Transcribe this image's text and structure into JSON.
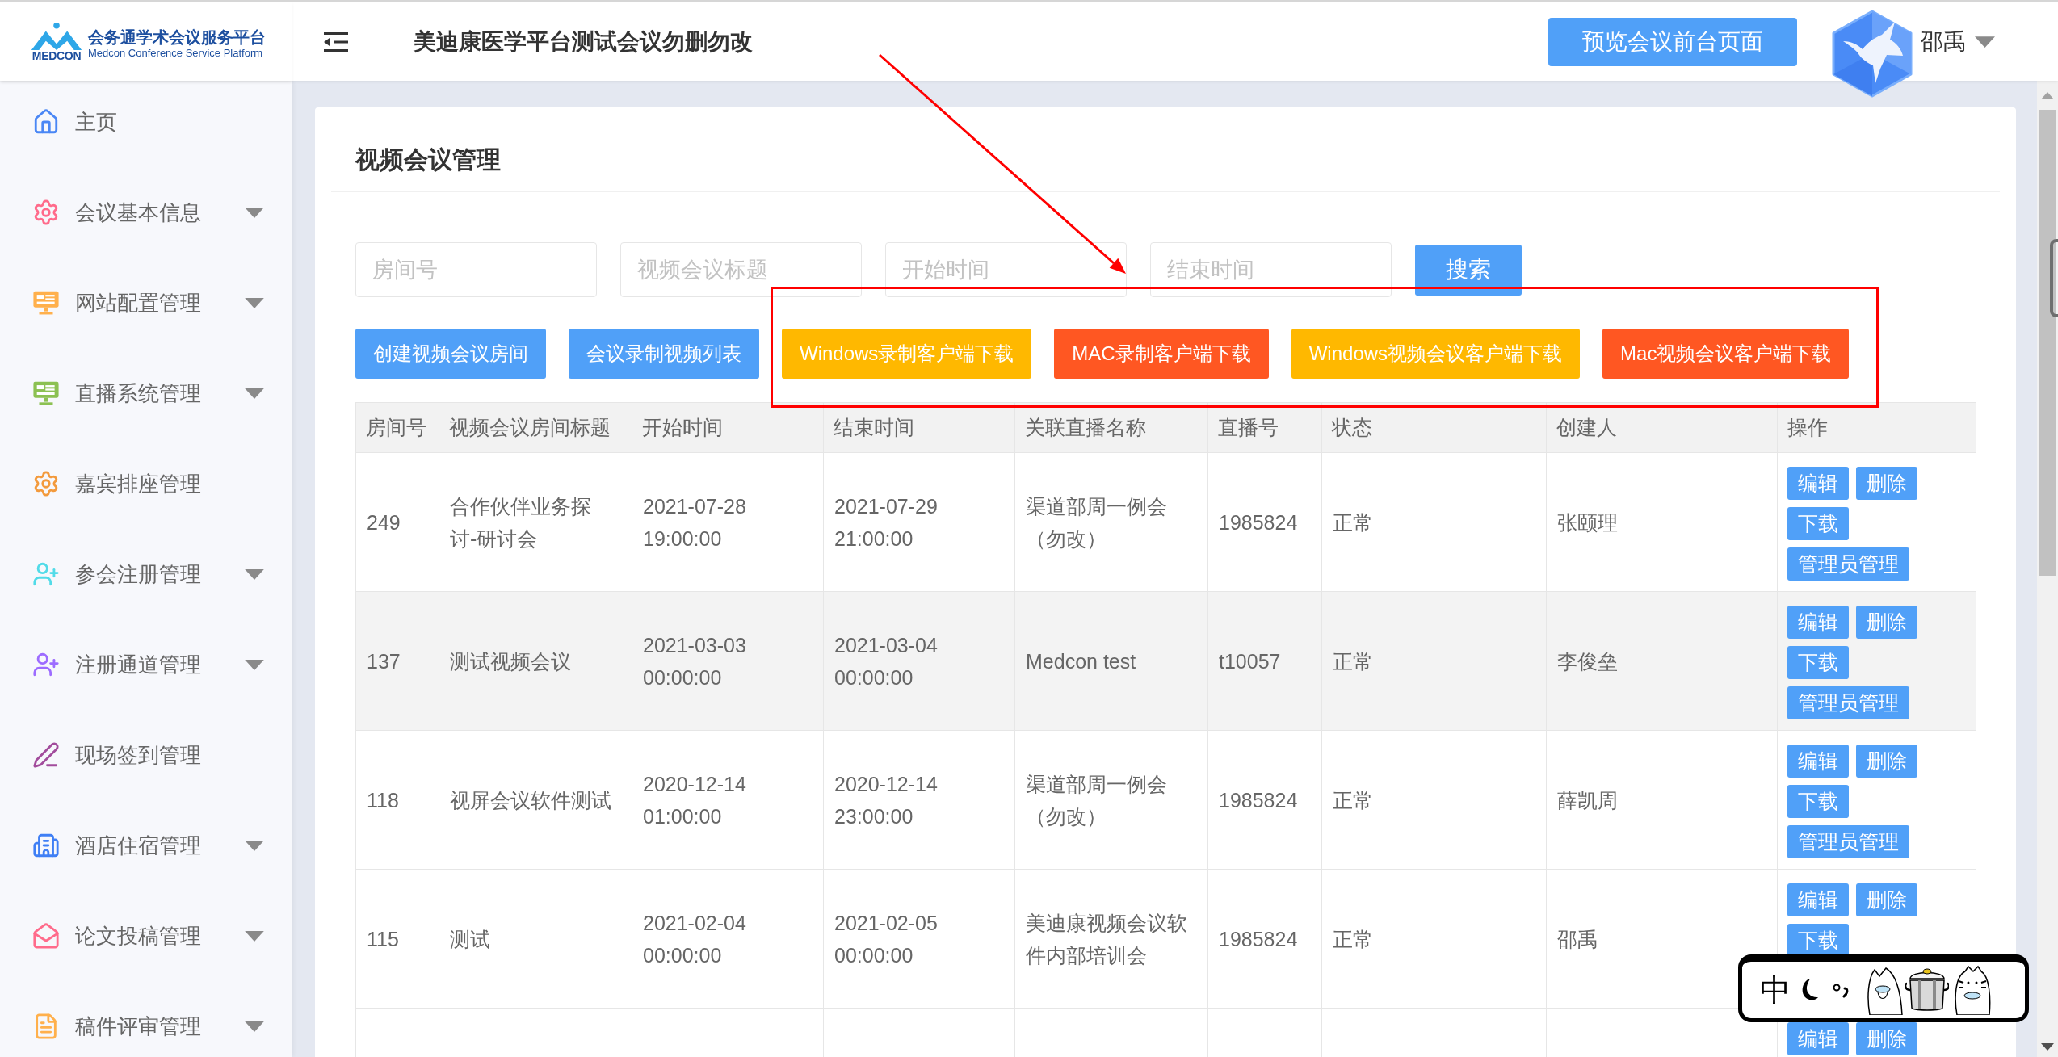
{
  "logo": {
    "mark_text": "MEDCON",
    "title": "会务通学术会议服务平台",
    "subtitle": "Medcon Conference Service Platform"
  },
  "header": {
    "title": "美迪康医学平台测试会议勿删勿改",
    "preview_button": "预览会议前台页面",
    "user_name": "邵禹"
  },
  "sidebar": {
    "items": [
      {
        "label": "主页",
        "has_submenu": false
      },
      {
        "label": "会议基本信息",
        "has_submenu": true
      },
      {
        "label": "网站配置管理",
        "has_submenu": true
      },
      {
        "label": "直播系统管理",
        "has_submenu": true
      },
      {
        "label": "嘉宾排座管理",
        "has_submenu": false
      },
      {
        "label": "参会注册管理",
        "has_submenu": true
      },
      {
        "label": "注册通道管理",
        "has_submenu": true
      },
      {
        "label": "现场签到管理",
        "has_submenu": false
      },
      {
        "label": "酒店住宿管理",
        "has_submenu": true
      },
      {
        "label": "论文投稿管理",
        "has_submenu": true
      },
      {
        "label": "稿件评审管理",
        "has_submenu": true
      }
    ]
  },
  "page": {
    "title": "视频会议管理",
    "filters": [
      {
        "placeholder": "房间号"
      },
      {
        "placeholder": "视频会议标题"
      },
      {
        "placeholder": "开始时间"
      },
      {
        "placeholder": "结束时间"
      }
    ],
    "search_button": "搜索",
    "buttons": [
      {
        "label": "创建视频会议房间",
        "color": "#50a0f8",
        "boxed": false
      },
      {
        "label": "会议录制视频列表",
        "color": "#50a0f8",
        "boxed": false
      },
      {
        "label": "Windows录制客户端下载",
        "color": "#ffb800",
        "boxed": true
      },
      {
        "label": "MAC录制客户端下载",
        "color": "#ff5722",
        "boxed": true
      },
      {
        "label": "Windows视频会议客户端下载",
        "color": "#ffb800",
        "boxed": true
      },
      {
        "label": "Mac视频会议客户端下载",
        "color": "#ff5722",
        "boxed": true
      }
    ],
    "table": {
      "columns": [
        "房间号",
        "视频会议房间标题",
        "开始时间",
        "结束时间",
        "关联直播名称",
        "直播号",
        "状态",
        "创建人",
        "操作"
      ],
      "rows": [
        {
          "highlighted": false,
          "cells": [
            "249",
            "合作伙伴业务探讨-研讨会",
            "2021-07-28 19:00:00",
            "2021-07-29 21:00:00",
            "渠道部周一例会（勿改）",
            "1985824",
            "正常",
            "张颐理"
          ],
          "actions": [
            "编辑",
            "删除",
            "下载",
            "管理员管理"
          ]
        },
        {
          "highlighted": true,
          "cells": [
            "137",
            "测试视频会议",
            "2021-03-03 00:00:00",
            "2021-03-04 00:00:00",
            "Medcon test",
            "t10057",
            "正常",
            "李俊垒"
          ],
          "actions": [
            "编辑",
            "删除",
            "下载",
            "管理员管理"
          ]
        },
        {
          "highlighted": false,
          "cells": [
            "118",
            "视屏会议软件测试",
            "2020-12-14 01:00:00",
            "2020-12-14 23:00:00",
            "渠道部周一例会（勿改）",
            "1985824",
            "正常",
            "薛凯周"
          ],
          "actions": [
            "编辑",
            "删除",
            "下载",
            "管理员管理"
          ]
        },
        {
          "highlighted": false,
          "cells": [
            "115",
            "测试",
            "2021-02-04 00:00:00",
            "2021-02-05 00:00:00",
            "美迪康视频会议软件内部培训会",
            "1985824",
            "正常",
            "邵禹"
          ],
          "actions": [
            "编辑",
            "删除",
            "下载"
          ]
        },
        {
          "highlighted": false,
          "actions": [
            "编辑",
            "删除"
          ]
        }
      ]
    }
  },
  "annotation": {
    "arrow": true
  },
  "input_method": {
    "mode": "中"
  }
}
